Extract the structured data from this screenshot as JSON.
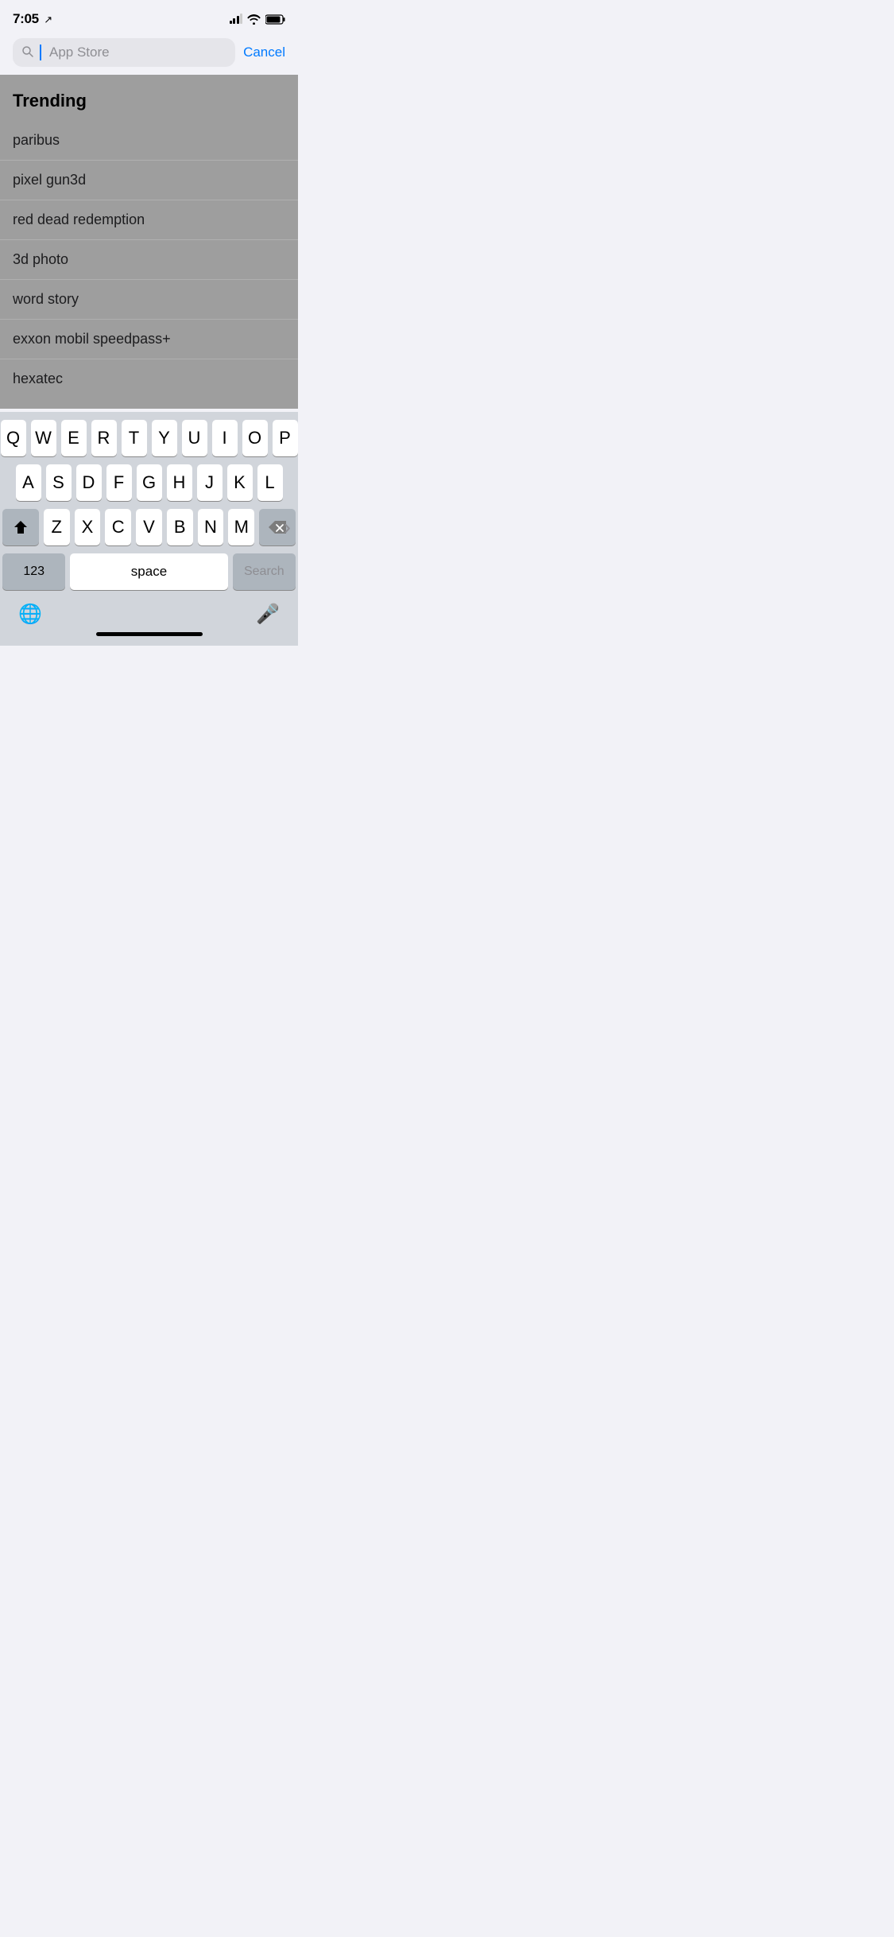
{
  "statusBar": {
    "time": "7:05",
    "locationIcon": "›",
    "signals": [
      1,
      2,
      3,
      4
    ],
    "battery": "battery"
  },
  "searchBar": {
    "placeholder": "App Store",
    "cancelLabel": "Cancel"
  },
  "trending": {
    "header": "Trending",
    "items": [
      "paribus",
      "pixel gun3d",
      "red dead redemption",
      "3d photo",
      "word story",
      "exxon mobil speedpass+",
      "hexatec"
    ]
  },
  "keyboard": {
    "row1": [
      "Q",
      "W",
      "E",
      "R",
      "T",
      "Y",
      "U",
      "I",
      "O",
      "P"
    ],
    "row2": [
      "A",
      "S",
      "D",
      "F",
      "G",
      "H",
      "J",
      "K",
      "L"
    ],
    "row3": [
      "Z",
      "X",
      "C",
      "V",
      "B",
      "N",
      "M"
    ],
    "numLabel": "123",
    "spaceLabel": "space",
    "searchLabel": "Search",
    "shiftLabel": "⬆",
    "deleteLabel": "⌫"
  },
  "bottomBar": {
    "globeIcon": "🌐",
    "micIcon": "🎤"
  }
}
